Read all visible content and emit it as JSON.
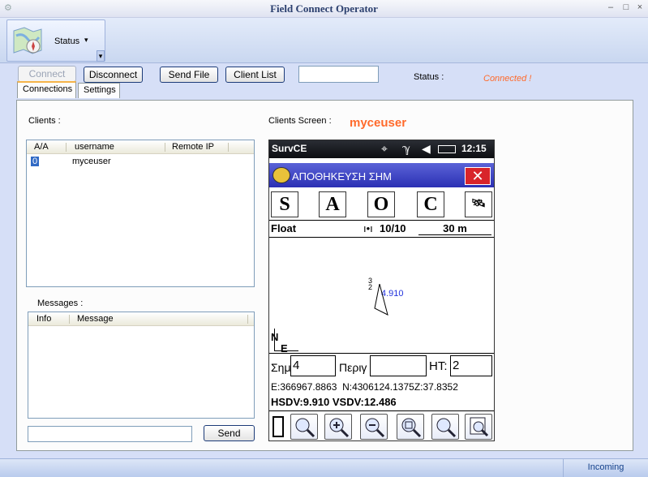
{
  "window": {
    "title": "Field Connect Operator",
    "minimize": "–",
    "maximize": "□",
    "close": "×"
  },
  "ribbon": {
    "status_label": "Status",
    "status_arrow": "▾",
    "overflow": "▾"
  },
  "toolbar": {
    "connect_label": "Connect",
    "disconnect_label": "Disconnect",
    "send_file_label": "Send File",
    "client_list_label": "Client List",
    "file_input_value": "",
    "status_label": "Status :",
    "status_value": "Connected !"
  },
  "tabs": [
    {
      "label": "Connections"
    },
    {
      "label": "Settings"
    }
  ],
  "clients": {
    "label": "Clients :",
    "columns": [
      "A/A",
      "username",
      "Remote IP"
    ],
    "rows": [
      {
        "aa": "0",
        "username": "myceuser",
        "ip": ""
      }
    ]
  },
  "messages": {
    "label": "Messages :",
    "columns": [
      "Info",
      "Message"
    ],
    "input_value": "",
    "send_label": "Send"
  },
  "clients_screen": {
    "label": "Clients Screen :",
    "user": "myceuser"
  },
  "device": {
    "app": "SurvCE",
    "time": "12:15",
    "header_title": "ΑΠΟΘΗΚΕΥΣΗ ΣΗΜ",
    "tools": [
      "S",
      "A",
      "O",
      "C"
    ],
    "solution": "Float",
    "sats": "10/10",
    "scale": "30 m",
    "north": "N",
    "east": "E",
    "map_label_a": "3",
    "map_label_b": "2",
    "map_label_c": "4.910",
    "pt_label": "Σημ",
    "pt_value": "4",
    "desc_label": "Περιγ",
    "desc_value": "",
    "ht_label": "HT:",
    "ht_value": "2",
    "coords": "E:366967.8863  N:4306124.1375Z:37.8352",
    "precision": "HSDV:9.910 VSDV:12.486"
  },
  "statusbar": {
    "incoming": "Incoming"
  },
  "colors": {
    "accent_status": "#ff6a2b",
    "device_header": "#3a3fc0",
    "frame": "#d6dff7"
  }
}
